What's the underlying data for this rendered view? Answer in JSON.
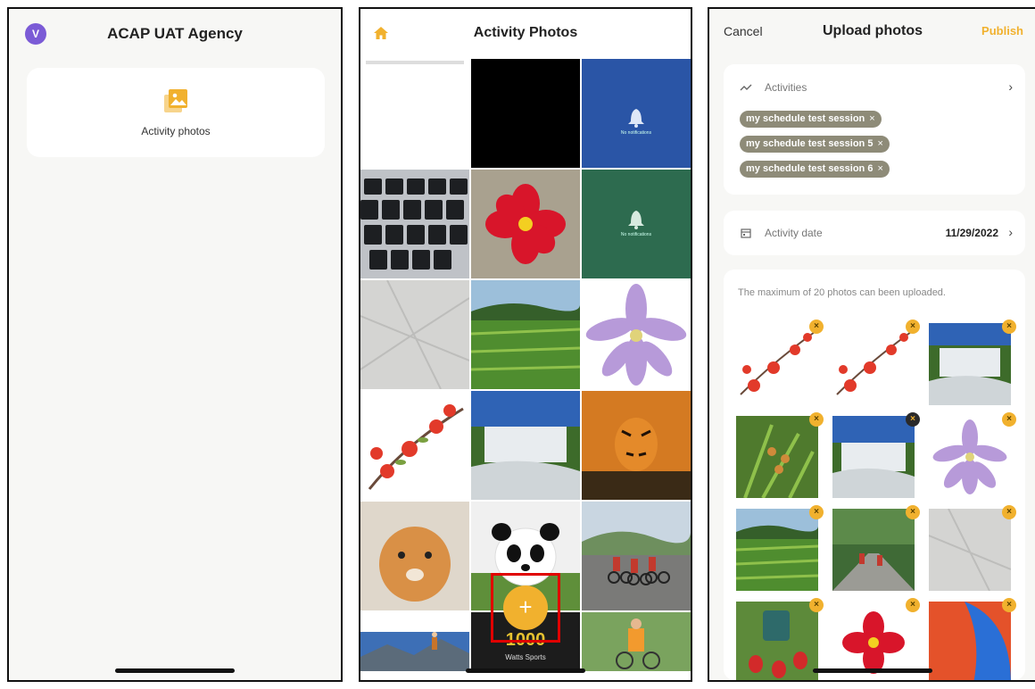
{
  "screen1": {
    "avatar_letter": "V",
    "title": "ACAP UAT Agency",
    "card_label": "Activity photos",
    "card_icon": "photo-library-icon"
  },
  "screen2": {
    "title": "Activity Photos",
    "home_icon": "home-icon",
    "fab_label": "+",
    "tiles": [
      {
        "name": "screenshot-blank",
        "alt": "blank screenshot"
      },
      {
        "name": "black-image",
        "alt": "black image"
      },
      {
        "name": "blue-notifications-screen",
        "text": "No notifications"
      },
      {
        "name": "keyboard-photo",
        "alt": "keyboard"
      },
      {
        "name": "red-flower",
        "alt": "red flower"
      },
      {
        "name": "green-notifications-screen",
        "text": "No notifications"
      },
      {
        "name": "tiled-floor",
        "alt": "tiled floor"
      },
      {
        "name": "rice-fields",
        "alt": "rice fields"
      },
      {
        "name": "purple-flower",
        "alt": "purple flower"
      },
      {
        "name": "red-blossom-branch",
        "alt": "red blossoms"
      },
      {
        "name": "waterfall",
        "alt": "waterfall"
      },
      {
        "name": "tiger-walking",
        "alt": "tiger"
      },
      {
        "name": "tiger-cub",
        "alt": "tiger cub"
      },
      {
        "name": "panda",
        "alt": "panda"
      },
      {
        "name": "cyclists-road",
        "alt": "cyclists"
      },
      {
        "name": "hiker-mountain",
        "alt": "hiker"
      },
      {
        "name": "watts-sports",
        "text": "Watts Sports"
      },
      {
        "name": "cyclist-green",
        "alt": "cyclist"
      }
    ]
  },
  "screen3": {
    "cancel_label": "Cancel",
    "title": "Upload photos",
    "publish_label": "Publish",
    "activities_label": "Activities",
    "chips": [
      "my schedule test session",
      "my schedule test session 5",
      "my schedule test session 6"
    ],
    "chip_remove": "×",
    "date_label": "Activity date",
    "date_value": "11/29/2022",
    "max_note": "The maximum of 20 photos can been uploaded.",
    "remove_glyph": "×",
    "photos": [
      "red-blossom-1",
      "red-blossom-2",
      "waterfall-1",
      "orchid-green",
      "waterfall-2",
      "purple-flower",
      "rice-field",
      "cyclists-park",
      "tiled-floor",
      "strawberries",
      "red-flower",
      "wallpaper-red-blue"
    ]
  },
  "colors": {
    "accent": "#f1b12e",
    "avatar": "#7b5bd6",
    "chip": "#8e8b78",
    "highlight": "#e00000"
  }
}
